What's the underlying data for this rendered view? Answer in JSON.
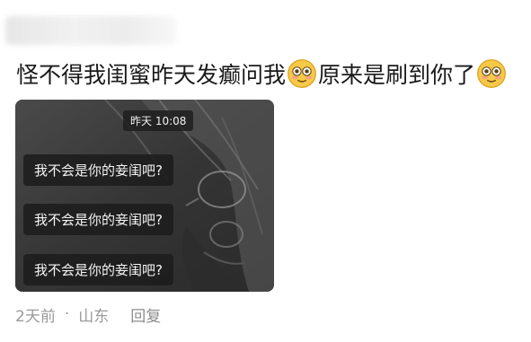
{
  "post": {
    "text_part1": "怪不得我闺蜜昨天发癫问我",
    "text_part2": "原来是刷到你了",
    "emoji_icon": "flushed-face-emoji"
  },
  "media": {
    "timestamp": "昨天 10:08",
    "messages": [
      "我不会是你的妾闺吧?",
      "我不会是你的妾闺吧?",
      "我不会是你的妾闺吧?"
    ]
  },
  "meta": {
    "time_ago": "2天前",
    "separator": "·",
    "location": "山东",
    "reply_label": "回复"
  },
  "colors": {
    "text": "#1a1a1a",
    "meta": "#9a9a9a",
    "bubble_bg": "#1c1c1c",
    "emoji_yellow": "#f7c948"
  }
}
